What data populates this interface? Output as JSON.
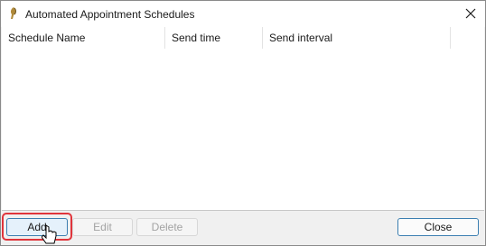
{
  "window": {
    "title": "Automated Appointment Schedules",
    "app_icon": "app-icon",
    "close_icon": "close-icon"
  },
  "list": {
    "columns": [
      "Schedule Name",
      "Send time",
      "Send interval",
      ""
    ],
    "rows": []
  },
  "buttons": {
    "add": "Add",
    "edit": "Edit",
    "delete": "Delete",
    "close": "Close"
  },
  "colors": {
    "highlight": "#e0343b",
    "focus_border": "#3c7fb1"
  }
}
